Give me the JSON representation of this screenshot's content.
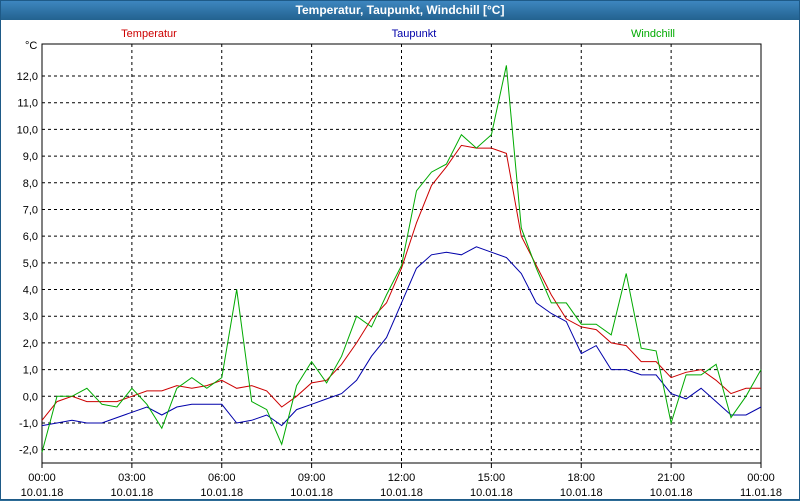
{
  "window": {
    "title": "Temperatur, Taupunkt, Windchill [°C]"
  },
  "chart_data": {
    "type": "line",
    "title": "Temperatur, Taupunkt, Windchill [°C]",
    "ylabel": "°C",
    "ylim": [
      -2.5,
      13.2
    ],
    "yticks": [
      "-2,0",
      "-1,0",
      "0,0",
      "1,0",
      "2,0",
      "3,0",
      "4,0",
      "5,0",
      "6,0",
      "7,0",
      "8,0",
      "9,0",
      "10,0",
      "11,0",
      "12,0"
    ],
    "xtick_labels": [
      {
        "time": "00:00",
        "date": "10.01.18"
      },
      {
        "time": "03:00",
        "date": "10.01.18"
      },
      {
        "time": "06:00",
        "date": "10.01.18"
      },
      {
        "time": "09:00",
        "date": "10.01.18"
      },
      {
        "time": "12:00",
        "date": "10.01.18"
      },
      {
        "time": "15:00",
        "date": "10.01.18"
      },
      {
        "time": "18:00",
        "date": "10.01.18"
      },
      {
        "time": "21:00",
        "date": "10.01.18"
      },
      {
        "time": "00:00",
        "date": "11.01.18"
      }
    ],
    "x_hours": [
      0,
      0.5,
      1,
      1.5,
      2,
      2.5,
      3,
      3.5,
      4,
      4.5,
      5,
      5.5,
      6,
      6.5,
      7,
      7.5,
      8,
      8.5,
      9,
      9.5,
      10,
      10.5,
      11,
      11.5,
      12,
      12.5,
      13,
      13.5,
      14,
      14.5,
      15,
      15.5,
      16,
      16.5,
      17,
      17.5,
      18,
      18.5,
      19,
      19.5,
      20,
      20.5,
      21,
      21.5,
      22,
      22.5,
      23,
      23.5,
      24
    ],
    "grid": true,
    "legend_position": "top",
    "series": [
      {
        "name": "Temperatur",
        "color": "#cc0000",
        "values": [
          -0.9,
          -0.2,
          0.0,
          -0.2,
          -0.2,
          -0.2,
          0.0,
          0.2,
          0.2,
          0.4,
          0.3,
          0.4,
          0.6,
          0.3,
          0.4,
          0.2,
          -0.4,
          0.0,
          0.5,
          0.6,
          1.2,
          2.0,
          2.9,
          3.5,
          4.8,
          6.5,
          7.9,
          8.6,
          9.4,
          9.3,
          9.3,
          9.1,
          6.0,
          4.9,
          3.8,
          2.9,
          2.6,
          2.5,
          2.0,
          1.9,
          1.3,
          1.3,
          0.7,
          0.9,
          1.0,
          0.6,
          0.1,
          0.3,
          0.3
        ]
      },
      {
        "name": "Taupunkt",
        "color": "#0000aa",
        "values": [
          -1.1,
          -1.0,
          -0.9,
          -1.0,
          -1.0,
          -0.8,
          -0.6,
          -0.4,
          -0.7,
          -0.4,
          -0.3,
          -0.3,
          -0.3,
          -1.0,
          -0.9,
          -0.7,
          -1.1,
          -0.5,
          -0.3,
          -0.1,
          0.1,
          0.6,
          1.5,
          2.2,
          3.5,
          4.8,
          5.3,
          5.4,
          5.3,
          5.6,
          5.4,
          5.2,
          4.6,
          3.5,
          3.1,
          2.8,
          1.6,
          1.9,
          1.0,
          1.0,
          0.8,
          0.8,
          0.1,
          -0.1,
          0.3,
          -0.2,
          -0.7,
          -0.7,
          -0.4
        ]
      },
      {
        "name": "Windchill",
        "color": "#00aa00",
        "values": [
          -2.1,
          0.0,
          0.0,
          0.3,
          -0.3,
          -0.4,
          0.3,
          -0.3,
          -1.2,
          0.3,
          0.7,
          0.3,
          0.7,
          4.0,
          -0.2,
          -0.5,
          -1.8,
          0.4,
          1.3,
          0.5,
          1.5,
          3.0,
          2.6,
          3.8,
          4.9,
          7.7,
          8.4,
          8.7,
          9.8,
          9.3,
          9.8,
          12.4,
          6.3,
          4.8,
          3.5,
          3.5,
          2.7,
          2.7,
          2.3,
          4.6,
          1.8,
          1.7,
          -1.0,
          0.8,
          0.8,
          1.2,
          -0.8,
          0.0,
          1.0
        ]
      }
    ]
  }
}
